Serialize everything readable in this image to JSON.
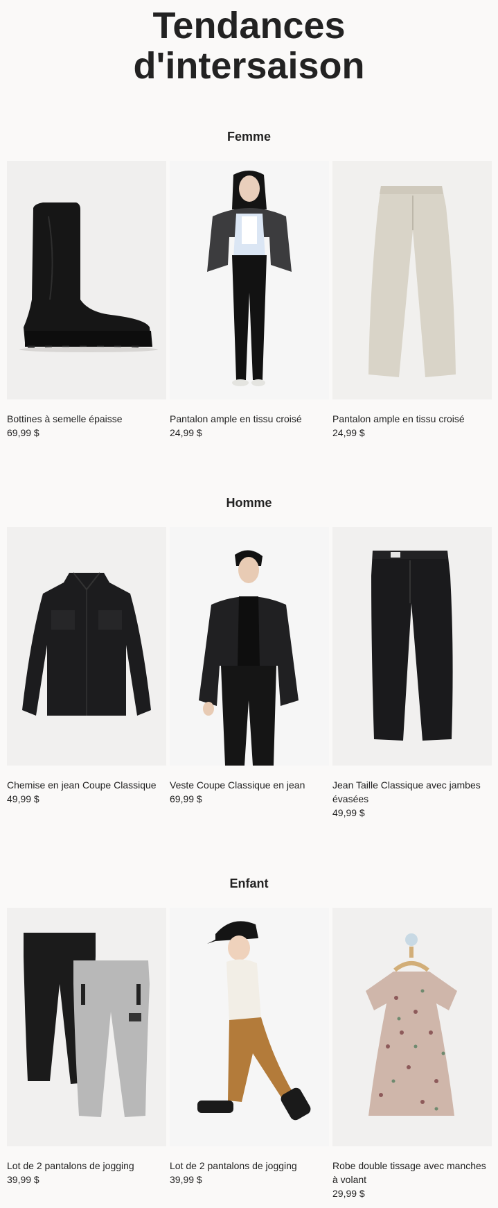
{
  "page": {
    "title_line1": "Tendances",
    "title_line2": "d'intersaison"
  },
  "sections": [
    {
      "title": "Femme",
      "products": [
        {
          "name": "Bottines à semelle épaisse",
          "price": "69,99 $",
          "image": "black-chunky-boot"
        },
        {
          "name": "Pantalon ample en tissu croisé",
          "price": "24,99 $",
          "image": "woman-varsity-jacket-black-pants"
        },
        {
          "name": "Pantalon ample en tissu croisé",
          "price": "24,99 $",
          "image": "beige-wide-pants"
        }
      ]
    },
    {
      "title": "Homme",
      "products": [
        {
          "name": "Chemise en jean Coupe Classique",
          "price": "49,99 $",
          "image": "black-denim-shirt"
        },
        {
          "name": "Veste Coupe Classique en jean",
          "price": "69,99 $",
          "image": "man-black-denim-jacket"
        },
        {
          "name": "Jean Taille Classique avec jambes évasées",
          "price": "49,99 $",
          "image": "black-flared-jeans"
        }
      ]
    },
    {
      "title": "Enfant",
      "products": [
        {
          "name": "Lot de 2 pantalons de jogging",
          "price": "39,99 $",
          "image": "two-jogging-pants"
        },
        {
          "name": "Lot de 2 pantalons de jogging",
          "price": "39,99 $",
          "image": "boy-cap-joggers"
        },
        {
          "name": "Robe double tissage avec manches à volant",
          "price": "29,99 $",
          "image": "floral-dress-hanger"
        }
      ]
    }
  ]
}
